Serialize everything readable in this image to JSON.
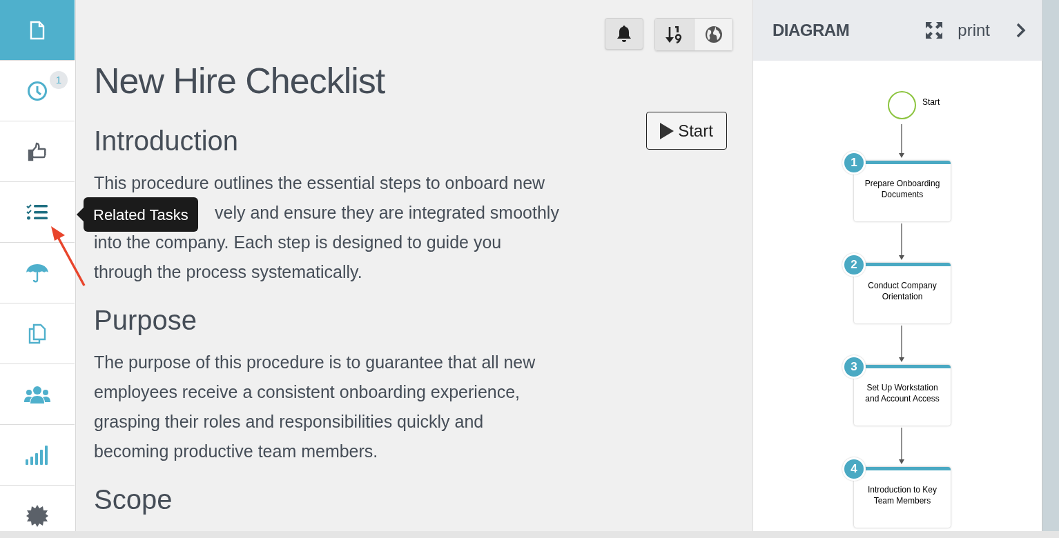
{
  "sidebar": {
    "items": [
      {
        "kind": "document",
        "selected": true
      },
      {
        "kind": "clock",
        "selected": false,
        "badge": "1"
      },
      {
        "kind": "thumbs-up",
        "selected": false
      },
      {
        "kind": "task-list",
        "selected": false
      },
      {
        "kind": "umbrella",
        "selected": false
      },
      {
        "kind": "copy",
        "selected": false
      },
      {
        "kind": "users",
        "selected": false
      },
      {
        "kind": "signal",
        "selected": false
      },
      {
        "kind": "gear",
        "selected": false
      }
    ]
  },
  "tooltip": {
    "text": "Related Tasks"
  },
  "toolbar": [
    {
      "kind": "bell",
      "pressed": true
    },
    {
      "kind": "sort",
      "pressed": true
    },
    {
      "kind": "globe",
      "pressed": false
    }
  ],
  "start_button": {
    "label": "Start"
  },
  "document": {
    "title": "New Hire Checklist",
    "sections": [
      {
        "heading": "Introduction",
        "lines": [
          {
            "text": "This procedure outlines the essential steps to onboard new",
            "kind": "full"
          },
          {
            "text": "vely and ensure they are integrated smoothly",
            "kind": "behind_tooltip"
          },
          {
            "text": "into the company. Each step is designed to guide you",
            "kind": "full"
          },
          {
            "text": "through the process systematically.",
            "kind": "full"
          }
        ]
      },
      {
        "heading": "Purpose",
        "lines": [
          {
            "text": "The purpose of this procedure is to guarantee that all new",
            "kind": "full"
          },
          {
            "text": "employees receive a consistent onboarding experience,",
            "kind": "full"
          },
          {
            "text": "grasping their roles and responsibilities quickly and",
            "kind": "full"
          },
          {
            "text": "becoming productive team members.",
            "kind": "full"
          }
        ]
      },
      {
        "heading": "Scope"
      }
    ]
  },
  "diagram_panel": {
    "title": "DIAGRAM",
    "print": "print",
    "start_label": "Start",
    "steps": [
      {
        "number": "1",
        "label": "Prepare Onboarding Documents"
      },
      {
        "number": "2",
        "label": "Conduct Company Orientation"
      },
      {
        "number": "3",
        "label": "Set Up Workstation and Account Access"
      },
      {
        "number": "4",
        "label": "Introduction to Key Team Members"
      }
    ]
  }
}
